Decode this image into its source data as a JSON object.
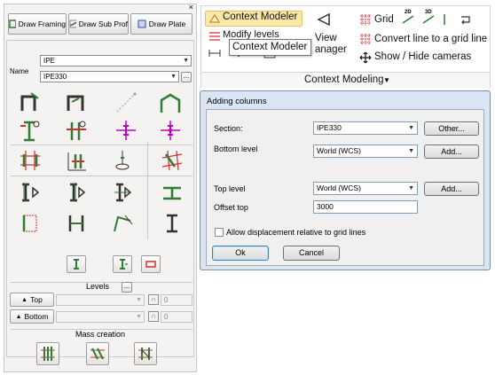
{
  "palette": {
    "close_glyph": "×",
    "buttons": {
      "draw_framing": "Draw Framing",
      "draw_sub_prof": "Draw Sub Prof",
      "draw_plate": "Draw Plate"
    },
    "name_label": "Name",
    "profile_family": "IPE",
    "profile_size": "IPE330",
    "browse_label": "...",
    "levels": {
      "title": "Levels",
      "more_label": "...",
      "top_label": "Top",
      "bottom_label": "Bottom",
      "top_value": "0",
      "bottom_value": "0"
    },
    "mass_creation": {
      "title": "Mass creation"
    }
  },
  "ribbon": {
    "context_modeler": "Context Modeler",
    "modify_levels": "Modify levels",
    "tooltip": "Context Modeler",
    "view_manager_line1": "View",
    "view_manager_line2": "anager",
    "grid": "Grid",
    "convert_line": "Convert line to a grid line",
    "show_hide_cameras": "Show / Hide cameras",
    "group_label": "Context Modeling",
    "grid_badge_2d": "2D",
    "grid_badge_3d": "3D"
  },
  "dialog": {
    "title": "Adding columns",
    "section_label": "Section:",
    "section_value": "IPE330",
    "other_button": "Other...",
    "bottom_level_label": "Bottom level",
    "bottom_level_value": "World (WCS)",
    "add_bottom_button": "Add...",
    "top_level_label": "Top level",
    "top_level_value": "World (WCS)",
    "add_top_button": "Add...",
    "offset_top_label": "Offset top",
    "offset_top_value": "3000",
    "allow_displacement_label": "Allow displacement relative to grid lines",
    "ok_button": "Ok",
    "cancel_button": "Cancel"
  },
  "colors": {
    "ribbon_highlight": "#fbe7a8",
    "dialog_frame": "#dbe6f4",
    "profile_green": "#2e7d32",
    "profile_red": "#d32f2f",
    "magenta": "#c000c0"
  }
}
